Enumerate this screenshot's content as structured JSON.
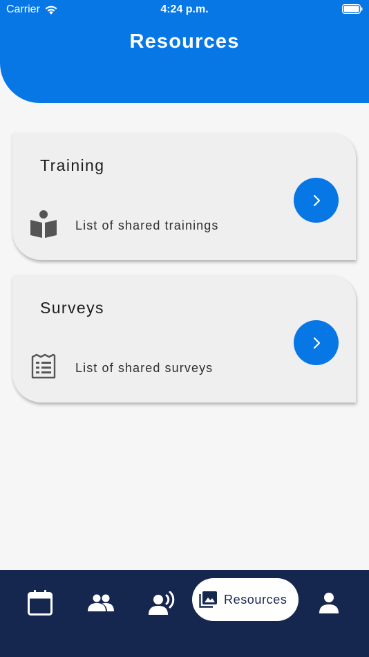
{
  "status_bar": {
    "carrier": "Carrier",
    "time": "4:24 p.m.",
    "icons": [
      "wifi-icon",
      "battery-icon"
    ]
  },
  "header": {
    "title": "Resources"
  },
  "cards": [
    {
      "title": "Training",
      "description": "List of shared trainings",
      "icon": "book-reader-icon",
      "action_icon": "chevron-right-icon"
    },
    {
      "title": "Surveys",
      "description": "List of shared surveys",
      "icon": "survey-list-icon",
      "action_icon": "chevron-right-icon"
    }
  ],
  "bottom_nav": {
    "items": [
      {
        "icon": "calendar-icon",
        "label": ""
      },
      {
        "icon": "people-icon",
        "label": ""
      },
      {
        "icon": "speaker-voice-icon",
        "label": ""
      },
      {
        "icon": "photo-library-icon",
        "label": "Resources",
        "selected": true
      },
      {
        "icon": "person-icon",
        "label": ""
      }
    ]
  },
  "colors": {
    "primary": "#0777e6",
    "nav_background": "#15264f",
    "card_background": "#efefef",
    "page_background": "#f6f6f6"
  }
}
